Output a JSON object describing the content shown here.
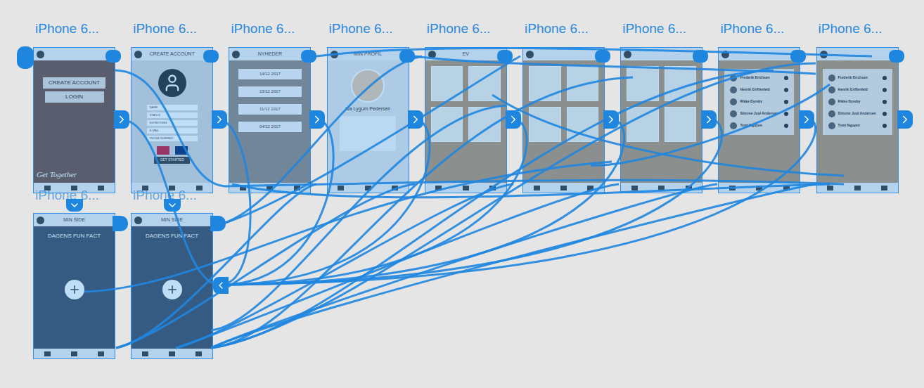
{
  "canvas": {
    "artboards": [
      {
        "label": "iPhone 6...",
        "title": "",
        "kind": "start",
        "items": [
          "CREATE ACCOUNT",
          "LOGIN",
          "Get Together"
        ]
      },
      {
        "label": "iPhone 6...",
        "title": "CREATE ACCOUNT",
        "kind": "form",
        "items": [
          "NAME",
          "STATUS",
          "EXPERTISES",
          "E-MAIL",
          "PHONE NUMMER",
          "GET STARTED"
        ]
      },
      {
        "label": "iPhone 6...",
        "title": "NYHEDER",
        "kind": "news",
        "items": [
          "14/12 2017",
          "13/12 2017",
          "11/12 2017",
          "04/12 2017"
        ]
      },
      {
        "label": "iPhone 6...",
        "title": "MIN PROFIL",
        "kind": "profile",
        "items": [
          "Ida Lygum Pedersen"
        ]
      },
      {
        "label": "iPhone 6...",
        "title": "EV",
        "kind": "cork",
        "items": []
      },
      {
        "label": "iPhone 6...",
        "title": "",
        "kind": "cork",
        "items": []
      },
      {
        "label": "iPhone 6...",
        "title": "",
        "kind": "cork",
        "items": []
      },
      {
        "label": "iPhone 6...",
        "title": "",
        "kind": "people",
        "items": [
          "Frederik Erichsen",
          "Henrik Griffenfeld",
          "Rikke Dyreby",
          "Simone Juul Andersen",
          "Tomi Nguyen"
        ]
      },
      {
        "label": "iPhone 6...",
        "title": "",
        "kind": "people",
        "items": [
          "Frederik Erichsen",
          "Henrik Griffenfeld",
          "Rikke Dyreby",
          "Simone Juul Andersen",
          "Tomi Nguyen"
        ]
      }
    ],
    "bottom_artboards": [
      {
        "label": "iPhone 6...",
        "title": "MIN SIDE",
        "kind": "side",
        "items": [
          "DAGENS FUN FACT"
        ]
      },
      {
        "label": "iPhone 6...",
        "title": "MIN SIDE",
        "kind": "side",
        "items": [
          "DAGENS FUN FACT"
        ]
      }
    ]
  }
}
